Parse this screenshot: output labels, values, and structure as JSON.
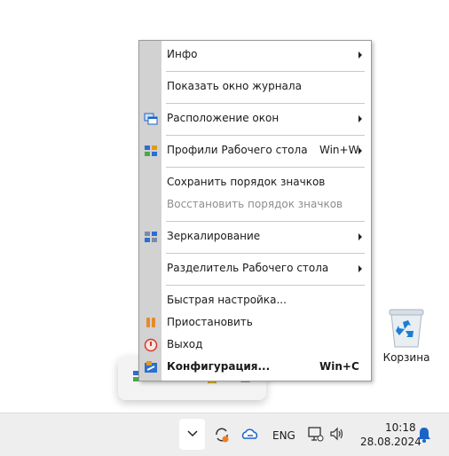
{
  "menu": {
    "items": [
      {
        "label": "Инфо",
        "submenu": true,
        "icon": null
      },
      {
        "label": "Показать окно журнала",
        "submenu": false,
        "icon": null
      },
      {
        "label": "Расположение окон",
        "submenu": true,
        "icon": "windows-layout-icon"
      },
      {
        "label": "Профили Рабочего стола",
        "shortcut": "Win+W",
        "submenu": true,
        "icon": "desktop-profiles-icon"
      },
      {
        "label": "Сохранить порядок значков",
        "submenu": false,
        "icon": null
      },
      {
        "label": "Восстановить порядок значков",
        "submenu": false,
        "disabled": true,
        "icon": null
      },
      {
        "label": "Зеркалирование",
        "submenu": true,
        "icon": "mirroring-icon"
      },
      {
        "label": "Разделитель Рабочего стола",
        "submenu": true,
        "icon": null
      },
      {
        "label": "Быстрая настройка...",
        "submenu": false,
        "icon": null
      },
      {
        "label": "Приостановить",
        "submenu": false,
        "icon": "pause-icon"
      },
      {
        "label": "Выход",
        "submenu": false,
        "icon": "power-icon"
      },
      {
        "label": "Конфигурация...",
        "shortcut": "Win+C",
        "bold": true,
        "icon": "config-icon"
      }
    ]
  },
  "desktop": {
    "recycle_bin_label": "Корзина"
  },
  "taskbar": {
    "language": "ENG",
    "time": "10:18",
    "date": "28.08.2024"
  },
  "colors": {
    "menu_gutter": "#d2d2d2",
    "taskbar_bg": "#eeeeee",
    "accent_blue": "#1a64c8",
    "disabled_text": "#8e8e8e"
  }
}
